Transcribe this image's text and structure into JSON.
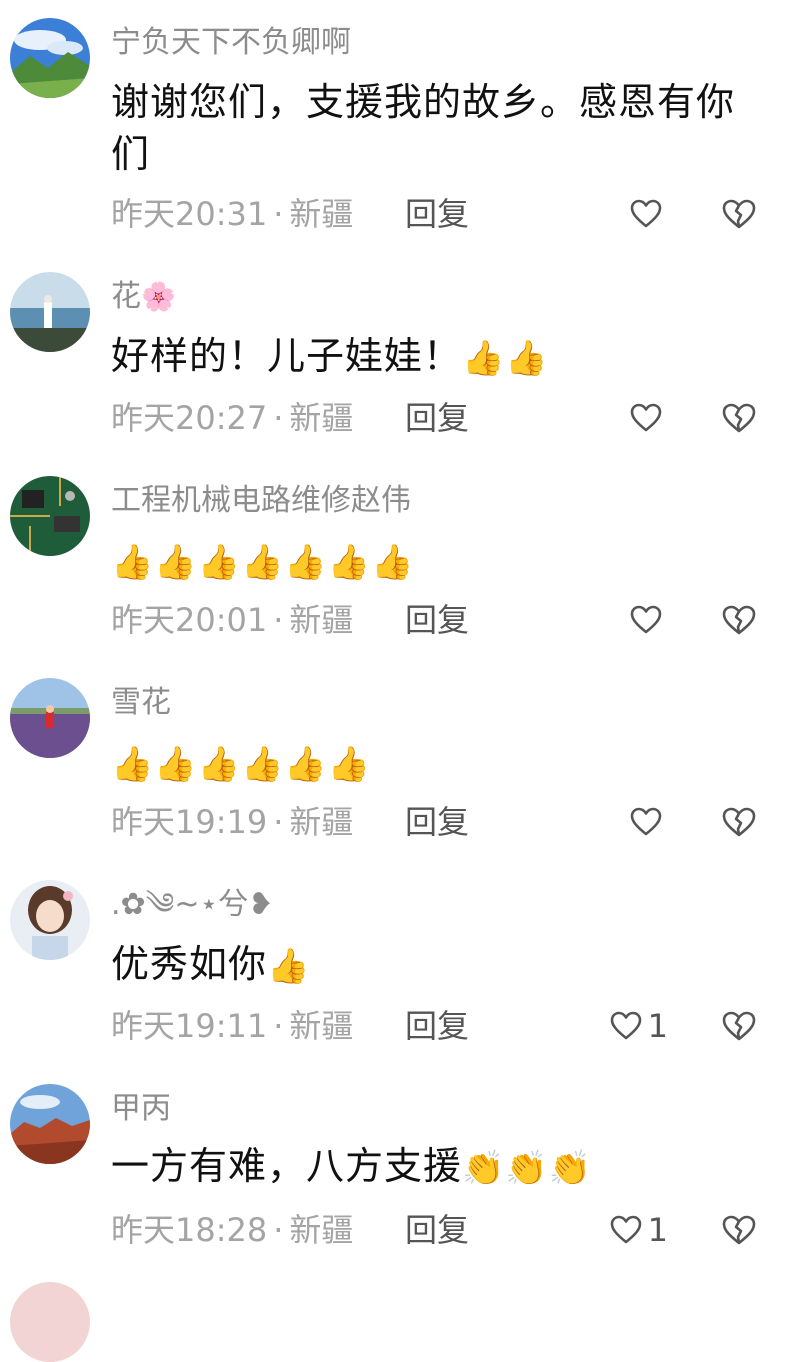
{
  "comments": [
    {
      "username": "宁负天下不负卿啊",
      "text": "谢谢您们，支援我的故乡。感恩有你们",
      "emoji": "",
      "time": "昨天20:31",
      "location": "新疆",
      "reply_label": "回复",
      "like_count": "",
      "avatar_icon": "mountain-landscape-avatar"
    },
    {
      "username": "花",
      "username_emoji": "🌸",
      "text": "好样的！儿子娃娃！",
      "emoji": "👍👍",
      "time": "昨天20:27",
      "location": "新疆",
      "reply_label": "回复",
      "like_count": "",
      "avatar_icon": "lake-person-avatar"
    },
    {
      "username": "工程机械电路维修赵伟",
      "text": "",
      "emoji": "👍👍👍👍👍👍👍",
      "time": "昨天20:01",
      "location": "新疆",
      "reply_label": "回复",
      "like_count": "",
      "avatar_icon": "circuit-board-avatar"
    },
    {
      "username": "雪花",
      "text": "",
      "emoji": "👍👍👍👍👍👍",
      "time": "昨天19:19",
      "location": "新疆",
      "reply_label": "回复",
      "like_count": "",
      "avatar_icon": "lavender-field-avatar"
    },
    {
      "username": ".✿༄~⋆兮❥",
      "text": "优秀如你",
      "emoji": "👍",
      "time": "昨天19:11",
      "location": "新疆",
      "reply_label": "回复",
      "like_count": "1",
      "avatar_icon": "girl-portrait-avatar"
    },
    {
      "username": "甲丙",
      "text": "一方有难，八方支援",
      "emoji": "👏👏👏",
      "time": "昨天18:28",
      "location": "新疆",
      "reply_label": "回复",
      "like_count": "1",
      "avatar_icon": "red-rock-avatar"
    }
  ],
  "separator": "·",
  "icons": {
    "like": "heart-outline-icon",
    "dislike": "broken-heart-icon"
  },
  "colors": {
    "username": "#8c8c8c",
    "text": "#111111",
    "meta": "#a4a4a4",
    "icon": "#555555"
  }
}
